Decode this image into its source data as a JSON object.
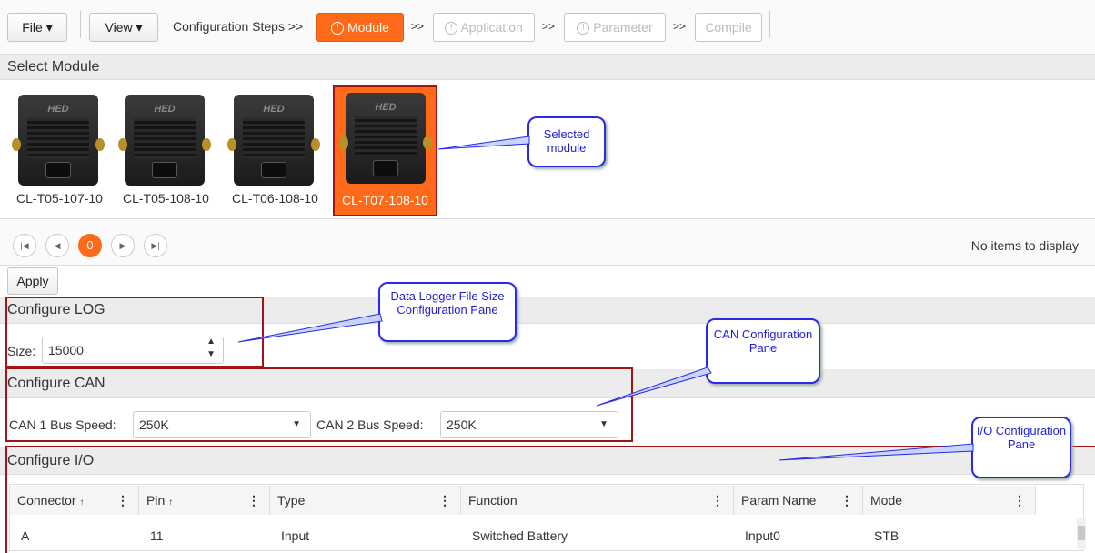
{
  "toolbar": {
    "file_label": "File ▾",
    "view_label": "View ▾",
    "steps_label": "Configuration Steps >>",
    "steps": [
      {
        "label": "Module",
        "state": "active"
      },
      {
        "label": "Application",
        "state": "disabled"
      },
      {
        "label": "Parameter",
        "state": "disabled"
      },
      {
        "label": "Compile",
        "state": "disabled"
      }
    ],
    "step_sep": ">>",
    "warn_icon": "!"
  },
  "select_module": {
    "title": "Select Module",
    "modules": [
      {
        "name": "CL-T05-107-10",
        "selected": false
      },
      {
        "name": "CL-T05-108-10",
        "selected": false
      },
      {
        "name": "CL-T06-108-10",
        "selected": false
      },
      {
        "name": "CL-T07-108-10",
        "selected": true
      }
    ],
    "device_logo": "HED",
    "selected_callout": "Selected module"
  },
  "pager": {
    "current_page": "0",
    "status": "No items to display"
  },
  "apply_label": "Apply",
  "log": {
    "title": "Configure LOG",
    "size_label": "Size:",
    "size_value": "15000",
    "callout": "Data Logger File Size Configuration Pane"
  },
  "can": {
    "title": "Configure CAN",
    "bus1_label": "CAN 1 Bus Speed:",
    "bus1_value": "250K",
    "bus2_label": "CAN 2 Bus Speed:",
    "bus2_value": "250K",
    "callout": "CAN Configuration Pane"
  },
  "io": {
    "title": "Configure I/O",
    "callout": "I/O Configuration Pane",
    "columns": [
      "Connector",
      "Pin",
      "Type",
      "Function",
      "Param Name",
      "Mode"
    ],
    "sort_arrow": "↑",
    "rows": [
      {
        "connector": "A",
        "pin": "11",
        "type": "Input",
        "function": "Switched Battery",
        "param": "Input0",
        "mode": "STB"
      }
    ]
  },
  "colors": {
    "accent": "#ff6a1a",
    "callout_blue": "#2a2ae8",
    "highlight_red": "#a31515"
  }
}
